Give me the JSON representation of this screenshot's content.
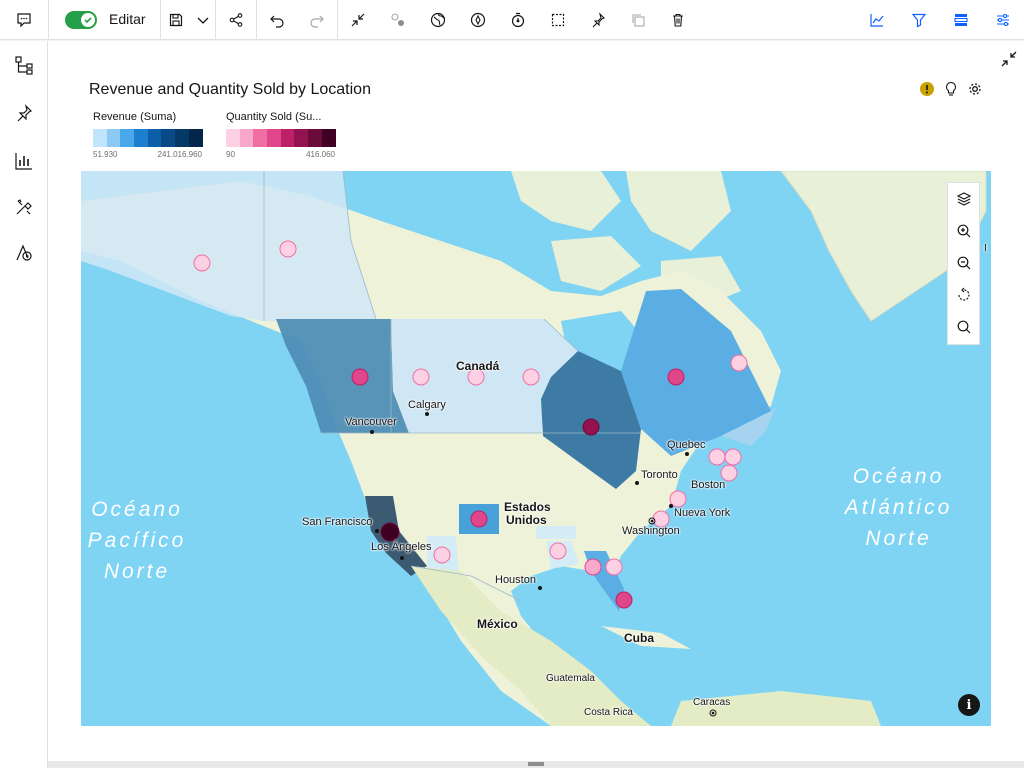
{
  "toolbar": {
    "edit_label": "Editar",
    "edit_toggle_on": true
  },
  "widget": {
    "title": "Revenue and Quantity Sold by Location"
  },
  "legend": {
    "revenue": {
      "title": "Revenue (Suma)",
      "min": "51.930",
      "max": "241.016.960",
      "colors": [
        "#bfe4fb",
        "#8ccaf5",
        "#4aa7e9",
        "#1f7fcf",
        "#0b5ea8",
        "#094a86",
        "#053865",
        "#03264a"
      ]
    },
    "quantity": {
      "title": "Quantity Sold (Su...",
      "min": "90",
      "max": "416.060",
      "colors": [
        "#fdd1e3",
        "#f8a8cb",
        "#ef6fa5",
        "#e0468a",
        "#bd1f69",
        "#93124f",
        "#6a0b39",
        "#400024"
      ]
    }
  },
  "map": {
    "labels": {
      "canada": "Canadá",
      "usa_1": "Estados",
      "usa_2": "Unidos",
      "mexico": "México",
      "cuba": "Cuba",
      "guatemala": "Guatemala",
      "costa_rica": "Costa Rica",
      "caracas": "Caracas",
      "vancouver": "Vancouver",
      "calgary": "Calgary",
      "toronto": "Toronto",
      "quebec": "Quebec",
      "boston": "Boston",
      "new_york": "Nueva York",
      "washington": "Washington",
      "san_francisco": "San Francisco",
      "los_angeles": "Los Ángeles",
      "houston": "Houston",
      "pacific_1": "Océano",
      "pacific_2": "Pacífico",
      "pacific_3": "Norte",
      "atlantic_1": "Océano",
      "atlantic_2": "Atlántico",
      "atlantic_3": "Norte",
      "edge_label": "I"
    }
  }
}
